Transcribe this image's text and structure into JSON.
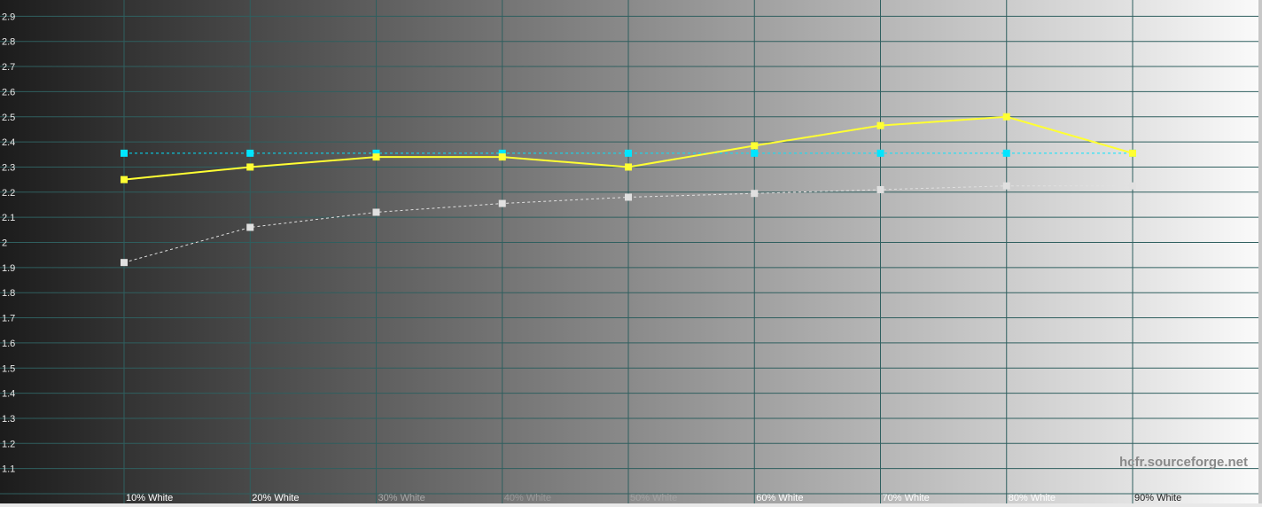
{
  "chart_data": {
    "type": "line",
    "title": "",
    "xlabel": "",
    "ylabel": "",
    "categories": [
      "10% White",
      "20% White",
      "30% White",
      "40% White",
      "50% White",
      "60% White",
      "70% White",
      "80% White",
      "90% White"
    ],
    "y_ticks": [
      "1.1",
      "1.2",
      "1.3",
      "1.4",
      "1.5",
      "1.6",
      "1.7",
      "1.8",
      "1.9",
      "2",
      "2.1",
      "2.2",
      "2.3",
      "2.4",
      "2.5",
      "2.6",
      "2.7",
      "2.8",
      "2.9"
    ],
    "ylim": [
      1.0,
      3.0
    ],
    "grid": true,
    "legend": "none",
    "background": "grayscale gradient dark-to-light",
    "series": [
      {
        "color": "#e0e0e0",
        "style": "dashed",
        "values": [
          1.92,
          2.06,
          2.12,
          2.155,
          2.18,
          2.195,
          2.21,
          2.225,
          2.225
        ]
      },
      {
        "color": "#00e5ff",
        "style": "dashed",
        "values": [
          2.355,
          2.355,
          2.355,
          2.355,
          2.355,
          2.355,
          2.355,
          2.355,
          2.355
        ]
      },
      {
        "color": "#ffff33",
        "style": "solid",
        "values": [
          2.25,
          2.3,
          2.34,
          2.34,
          2.3,
          2.385,
          2.465,
          2.5,
          2.355
        ]
      }
    ],
    "watermark": "hcfr.sourceforge.net",
    "colors": {
      "grid": "#2f5f5f"
    }
  }
}
